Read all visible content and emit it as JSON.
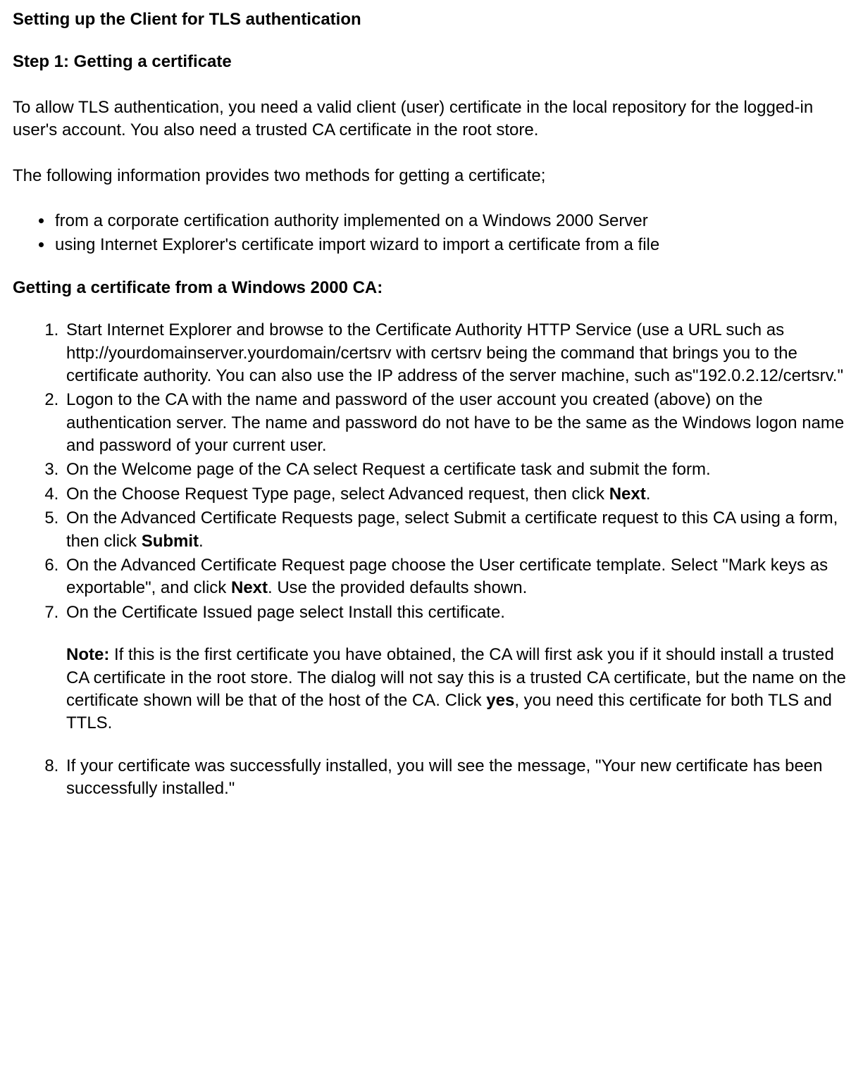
{
  "title": "Setting up the Client for TLS authentication",
  "step1_heading": "Step 1: Getting a certificate",
  "intro_p1": "To allow TLS authentication, you need a valid client (user) certificate in the local repository for the logged-in user's account.  You also need a trusted CA certificate in the root store.",
  "intro_p2": "The following information provides two methods for getting a certificate;",
  "methods": [
    "from a corporate certification authority implemented on a Windows 2000 Server",
    "using Internet Explorer's certificate import wizard to import a certificate from a file"
  ],
  "sub_heading": "Getting a certificate from a Windows 2000 CA:",
  "steps": {
    "s1": "Start Internet Explorer and browse to the Certificate Authority HTTP Service (use a URL such as http://yourdomainserver.yourdomain/certsrv with certsrv being the command that brings you to the certificate authority. You can also use the IP address of the server machine, such as\"192.0.2.12/certsrv.\"",
    "s2": "Logon to the CA with the name and password of the user account you created (above) on the authentication server. The name and password do not have to be the same as the Windows logon name and password of your current user.",
    "s3": "On the Welcome page of the CA select Request a certificate task and submit the form.",
    "s4_a": "On the Choose Request Type page, select Advanced request, then click ",
    "s4_b": "Next",
    "s4_c": ".",
    "s5_a": "On the Advanced Certificate Requests page, select Submit a certificate request to this CA using a form, then click ",
    "s5_b": "Submit",
    "s5_c": ".",
    "s6_a": "On the Advanced Certificate Request page choose the User certificate template. Select \"Mark keys as exportable\", and click ",
    "s6_b": "Next",
    "s6_c": ". Use the provided defaults shown.",
    "s7": "On the Certificate Issued page select Install this certificate.",
    "note_label": "Note:",
    "note_a": " If this is the first certificate you have obtained, the CA will first ask you if it should install a trusted CA certificate in the root store. The dialog will not say this is a trusted CA certificate, but the name on the certificate shown will be that of the host of the CA. Click ",
    "note_b": "yes",
    "note_c": ", you need this certificate for both TLS and TTLS.",
    "s8": "If your certificate was successfully installed, you will see the message, \"Your new certificate has been successfully installed.\""
  }
}
